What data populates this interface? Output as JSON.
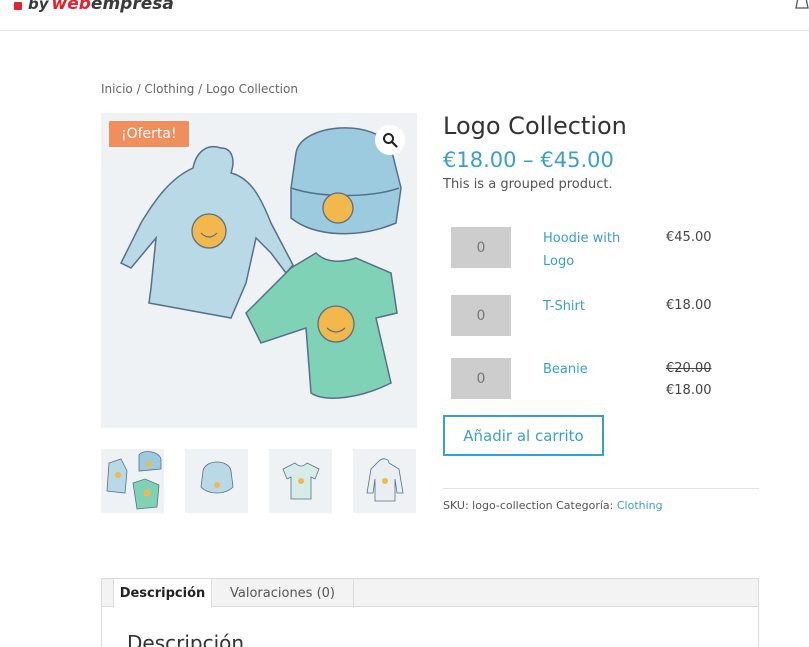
{
  "brand": {
    "by": "by",
    "web": "web",
    "empresa": "empresa"
  },
  "breadcrumb": "Inicio / Clothing / Logo Collection",
  "product": {
    "sale_badge": "¡Oferta!",
    "title": "Logo Collection",
    "price_low": "€18.00",
    "price_sep": "–",
    "price_high": "€45.00",
    "short_description": "This is a grouped product."
  },
  "grouped": [
    {
      "qty": "0",
      "name_line1": "Hoodie with",
      "name_line2": "Logo",
      "price": "€45.00"
    },
    {
      "qty": "0",
      "name_line1": "T-Shirt",
      "price": "€18.00"
    },
    {
      "qty": "0",
      "name_line1": "Beanie",
      "old_price": "€20.00",
      "price": "€18.00"
    }
  ],
  "add_to_cart": "Añadir al carrito",
  "meta": {
    "sku_label": "SKU:",
    "sku": "logo-collection",
    "category_label": "Categoría:",
    "category": "Clothing"
  },
  "tabs": [
    {
      "label": "Descripción"
    },
    {
      "label": "Valoraciones (0)"
    }
  ],
  "tab_content_heading": "Descripción",
  "colors": {
    "accent": "#3aa0c8",
    "sale": "#f08f5e",
    "brand_red": "#e4232e"
  }
}
